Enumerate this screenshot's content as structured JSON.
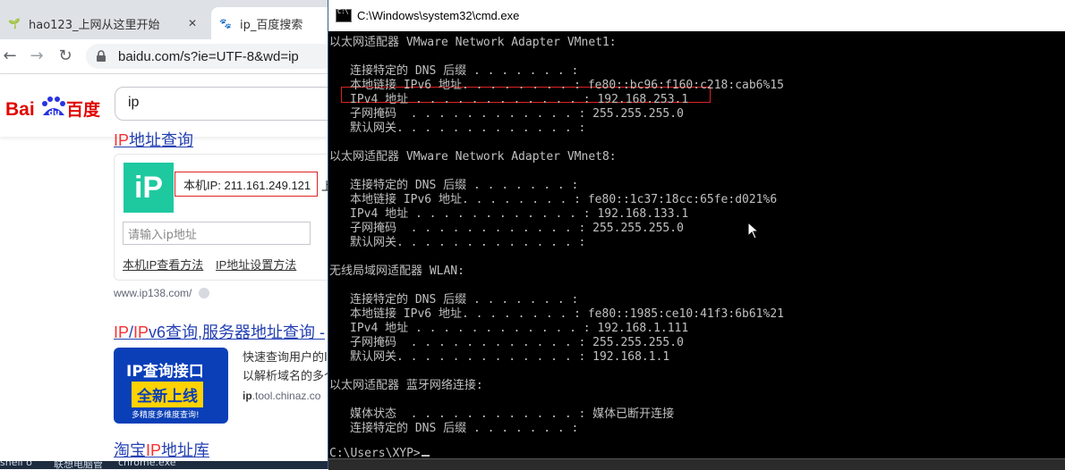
{
  "browser": {
    "tabs": [
      {
        "label": "hao123_上网从这里开始",
        "favicon": "hao-icon",
        "active": false
      },
      {
        "label": "ip_百度搜索",
        "favicon": "paw-icon",
        "active": true
      }
    ],
    "url": "baidu.com/s?ie=UTF-8&wd=ip",
    "logo_text": "Bai百度",
    "search_query": "ip"
  },
  "results": [
    {
      "title_hl": "IP",
      "title_rest": "地址查询",
      "ip_logo": "iP",
      "local_ip": "本机IP: 211.161.249.121",
      "local_ip_suffix": "上",
      "input_placeholder": "请输入ip地址",
      "link1": "本机IP查看方法",
      "link2": "IP地址设置方法",
      "source": "www.ip138.com/"
    },
    {
      "title_hl1": "IP",
      "title_sep": "/",
      "title_hl2": "IP",
      "title_rest": "v6查询,服务器地址查询 -",
      "ad_line1": "IP查询接口",
      "ad_line2": "全新上线",
      "ad_line3": "多精度多维度查询!",
      "snippet1": "快速查询用户的I",
      "snippet2": "以解析域名的多个",
      "url_bold": "ip",
      "url_rest": ".tool.chinaz.co"
    },
    {
      "title_pre": "淘宝",
      "title_hl": "IP",
      "title_rest": "地址库"
    }
  ],
  "taskbar": {
    "item1": "shell o",
    "item2": "联想电脑管",
    "item3": "chrome.exe"
  },
  "cmd": {
    "title": "C:\\Windows\\system32\\cmd.exe",
    "lines": [
      {
        "text": "以太网适配器 VMware Network Adapter VMnet1:",
        "indent": false
      },
      {
        "text": "",
        "indent": false
      },
      {
        "text": "连接特定的 DNS 后缀 . . . . . . . :",
        "indent": true
      },
      {
        "text": "本地链接 IPv6 地址. . . . . . . . : fe80::bc96:f160:c218:cab6%15",
        "indent": true
      },
      {
        "text": "IPv4 地址 . . . . . . . . . . . . : 192.168.253.1",
        "indent": true
      },
      {
        "text": "子网掩码  . . . . . . . . . . . . : 255.255.255.0",
        "indent": true
      },
      {
        "text": "默认网关. . . . . . . . . . . . . :",
        "indent": true
      },
      {
        "text": "",
        "indent": false
      },
      {
        "text": "以太网适配器 VMware Network Adapter VMnet8:",
        "indent": false
      },
      {
        "text": "",
        "indent": false
      },
      {
        "text": "连接特定的 DNS 后缀 . . . . . . . :",
        "indent": true
      },
      {
        "text": "本地链接 IPv6 地址. . . . . . . . : fe80::1c37:18cc:65fe:d021%6",
        "indent": true
      },
      {
        "text": "IPv4 地址 . . . . . . . . . . . . : 192.168.133.1",
        "indent": true
      },
      {
        "text": "子网掩码  . . . . . . . . . . . . : 255.255.255.0",
        "indent": true
      },
      {
        "text": "默认网关. . . . . . . . . . . . . :",
        "indent": true
      },
      {
        "text": "",
        "indent": false
      },
      {
        "text": "无线局域网适配器 WLAN:",
        "indent": false
      },
      {
        "text": "",
        "indent": false
      },
      {
        "text": "连接特定的 DNS 后缀 . . . . . . . :",
        "indent": true
      },
      {
        "text": "本地链接 IPv6 地址. . . . . . . . : fe80::1985:ce10:41f3:6b61%21",
        "indent": true
      },
      {
        "text": "IPv4 地址 . . . . . . . . . . . . : 192.168.1.111",
        "indent": true
      },
      {
        "text": "子网掩码  . . . . . . . . . . . . : 255.255.255.0",
        "indent": true
      },
      {
        "text": "默认网关. . . . . . . . . . . . . : 192.168.1.1",
        "indent": true
      },
      {
        "text": "",
        "indent": false
      },
      {
        "text": "以太网适配器 蓝牙网络连接:",
        "indent": false
      },
      {
        "text": "",
        "indent": false
      },
      {
        "text": "媒体状态  . . . . . . . . . . . . : 媒体已断开连接",
        "indent": true
      },
      {
        "text": "连接特定的 DNS 后缀 . . . . . . . :",
        "indent": true
      },
      {
        "text": "",
        "indent": false
      },
      {
        "text": "C:\\Users\\XYP>",
        "indent": false
      }
    ]
  }
}
